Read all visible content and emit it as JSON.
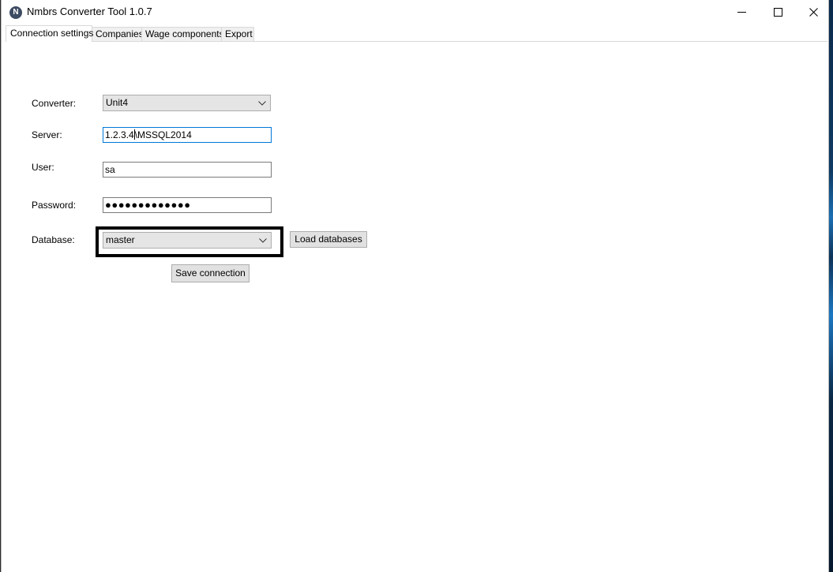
{
  "window": {
    "title": "Nmbrs Converter Tool 1.0.7",
    "app_icon_letter": "N"
  },
  "tabs": [
    {
      "label": "Connection  settings",
      "active": true
    },
    {
      "label": "Companies",
      "active": false
    },
    {
      "label": "Wage components",
      "active": false
    },
    {
      "label": "Export",
      "active": false
    }
  ],
  "form": {
    "converter_label": "Converter:",
    "converter_value": "Unit4",
    "server_label": "Server:",
    "server_value_before_caret": "1.2.3.4",
    "server_value_after_caret": "\\MSSQL2014",
    "user_label": "User:",
    "user_value": "sa",
    "password_label": "Password:",
    "password_value": "●●●●●●●●●●●●●",
    "database_label": "Database:",
    "database_value": "master",
    "load_databases_button": "Load databases",
    "save_connection_button": "Save connection"
  },
  "colors": {
    "focus_border": "#0078d7",
    "highlight_border": "#000000"
  }
}
